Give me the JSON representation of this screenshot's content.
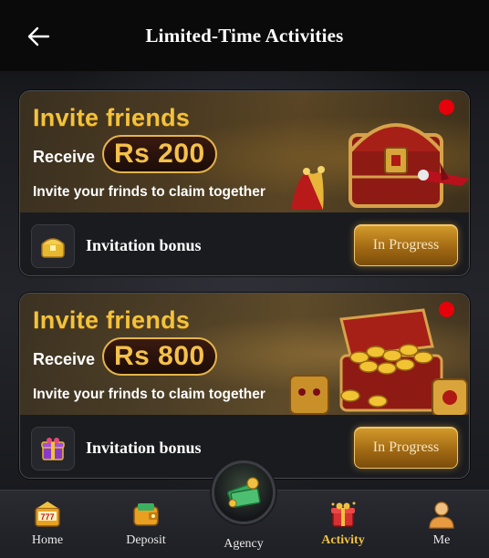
{
  "header": {
    "title": "Limited-Time Activities"
  },
  "cards": [
    {
      "banner_title": "Invite friends",
      "receive_label": "Receive",
      "amount": "Rs 200",
      "subtitle": "Invite your frinds to claim together",
      "bonus_label": "Invitation bonus",
      "button_label": "In Progress",
      "art_icon": "treasure-chest-with-jester-and-plane"
    },
    {
      "banner_title": "Invite friends",
      "receive_label": "Receive",
      "amount": "Rs 800",
      "subtitle": "Invite your frinds to claim together",
      "bonus_label": "Invitation bonus",
      "button_label": "In Progress",
      "art_icon": "gold-coins-treasure-chest"
    }
  ],
  "nav": {
    "items": [
      {
        "label": "Home",
        "icon": "home-777-icon"
      },
      {
        "label": "Deposit",
        "icon": "wallet-icon"
      },
      {
        "label": "Agency",
        "icon": "money-cash-icon"
      },
      {
        "label": "Activity",
        "icon": "gift-icon",
        "active": true
      },
      {
        "label": "Me",
        "icon": "user-icon"
      }
    ]
  },
  "colors": {
    "accent_gold": "#f3c23c",
    "active_nav": "#f0c040",
    "notification_dot": "#e6000a"
  }
}
